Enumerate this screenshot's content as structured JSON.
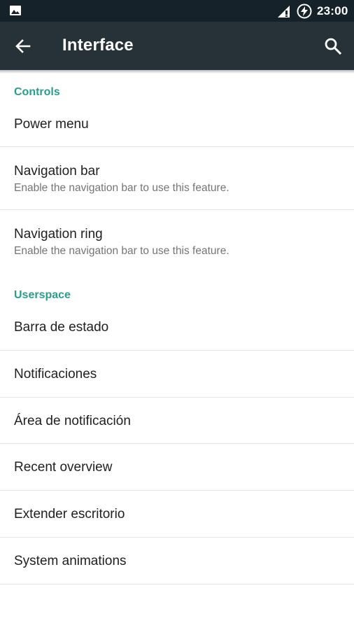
{
  "status_bar": {
    "time": "23:00",
    "icons": [
      "gallery-icon",
      "signal-icon",
      "battery-charging-icon"
    ]
  },
  "app_bar": {
    "title": "Interface",
    "icons": [
      "back-arrow-icon",
      "search-icon"
    ],
    "color": "#263238"
  },
  "accent_color": "#2a9d8f",
  "sections": [
    {
      "header": "Controls",
      "items": [
        {
          "title": "Power menu"
        },
        {
          "title": "Navigation bar",
          "summary": "Enable the navigation bar to use this feature."
        },
        {
          "title": "Navigation ring",
          "summary": "Enable the navigation bar to use this feature."
        }
      ]
    },
    {
      "header": "Userspace",
      "items": [
        {
          "title": "Barra de estado"
        },
        {
          "title": "Notificaciones"
        },
        {
          "title": "Área de notificación"
        },
        {
          "title": "Recent overview"
        },
        {
          "title": "Extender escritorio"
        },
        {
          "title": "System animations"
        }
      ]
    }
  ]
}
